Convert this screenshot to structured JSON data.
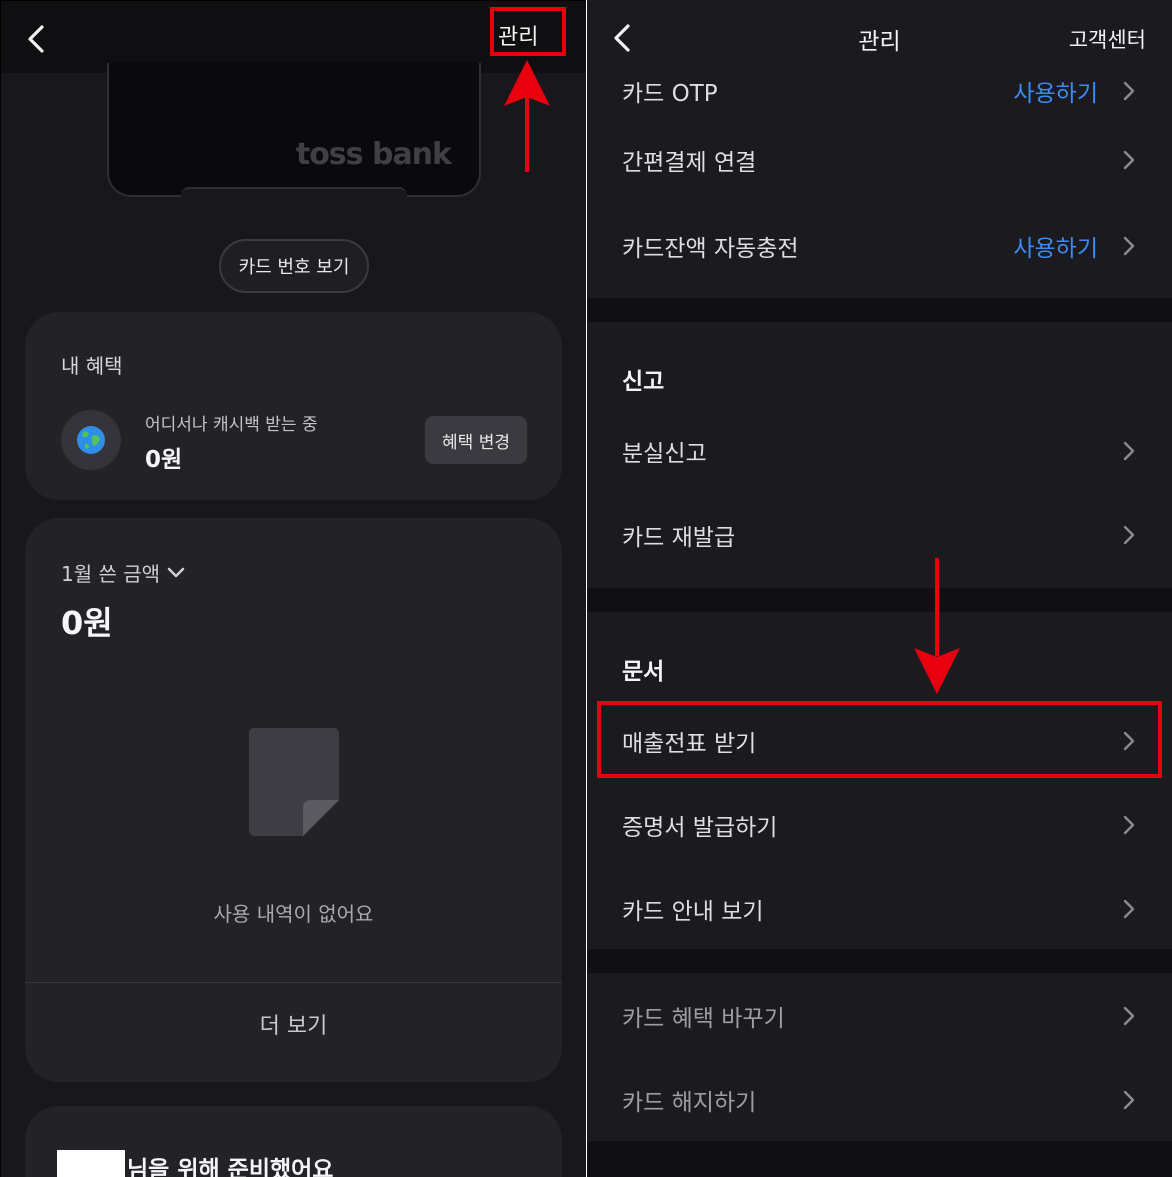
{
  "left": {
    "header": {
      "manage_label": "관리"
    },
    "card": {
      "logo": "toss bank"
    },
    "card_number_button": "카드 번호 보기",
    "benefit": {
      "title": "내 혜택",
      "cashback_label": "어디서나 캐시백 받는 중",
      "cashback_value": "0원",
      "change_button": "혜택 변경"
    },
    "spending": {
      "month_label": "1월 쓴 금액",
      "amount": "0원",
      "empty_text": "사용 내역이 없어요",
      "more_label": "더 보기"
    },
    "prepared": {
      "suffix": "님을 위해 준비했어요"
    }
  },
  "right": {
    "header": {
      "title": "관리",
      "customer_center": "고객센터"
    },
    "top_group": [
      {
        "label": "카드 OTP",
        "action": "사용하기"
      },
      {
        "label": "간편결제 연결",
        "action": ""
      },
      {
        "label": "카드잔액 자동충전",
        "action": "사용하기"
      }
    ],
    "report_group": {
      "title": "신고",
      "items": [
        "분실신고",
        "카드 재발급"
      ]
    },
    "document_group": {
      "title": "문서",
      "items": [
        "매출전표 받기",
        "증명서 발급하기",
        "카드 안내 보기"
      ]
    },
    "bottom_group": {
      "items": [
        "카드 혜택 바꾸기",
        "카드 해지하기"
      ]
    }
  },
  "colors": {
    "annotation_red": "#e8000e",
    "link_blue": "#3d8bf2",
    "background_dark": "#17171c",
    "card_surface": "#222227"
  }
}
